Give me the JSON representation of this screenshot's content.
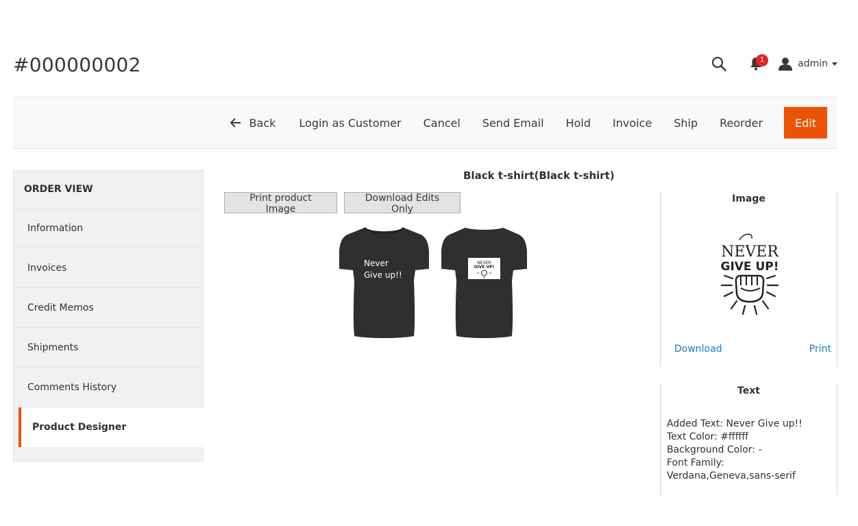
{
  "header": {
    "order_number": "#000000002",
    "notification_count": "1",
    "user_name": "admin",
    "icons": [
      "search-icon",
      "bell-icon",
      "user-icon",
      "chevron-down-icon"
    ]
  },
  "actions": {
    "back": "Back",
    "login_as_customer": "Login as Customer",
    "cancel": "Cancel",
    "send_email": "Send Email",
    "hold": "Hold",
    "invoice": "Invoice",
    "ship": "Ship",
    "reorder": "Reorder",
    "edit": "Edit"
  },
  "sidebar": {
    "title": "ORDER VIEW",
    "items": [
      {
        "label": "Information"
      },
      {
        "label": "Invoices"
      },
      {
        "label": "Credit Memos"
      },
      {
        "label": "Shipments"
      },
      {
        "label": "Comments History"
      },
      {
        "label": "Product Designer"
      }
    ],
    "active_index": 5
  },
  "designer": {
    "product_title": "Black t-shirt(Black t-shirt)",
    "print_button": "Print product Image",
    "download_button": "Download Edits Only",
    "front_text_line1": "Never",
    "front_text_line2": "Give up!!",
    "image_panel": {
      "title": "Image",
      "artwork_line1": "NEVER",
      "artwork_line2": "GIVE UP!",
      "download": "Download",
      "print": "Print"
    },
    "text_panel": {
      "title": "Text",
      "added_text": "Added Text: Never Give up!!",
      "text_color": "Text Color: #ffffff",
      "background_color": "Background Color: -",
      "font_family": "Font Family: Verdana,Geneva,sans-serif"
    }
  },
  "colors": {
    "accent": "#eb5202",
    "link": "#1979c3",
    "badge": "#e22626",
    "shirt": "#2f2f2f"
  }
}
